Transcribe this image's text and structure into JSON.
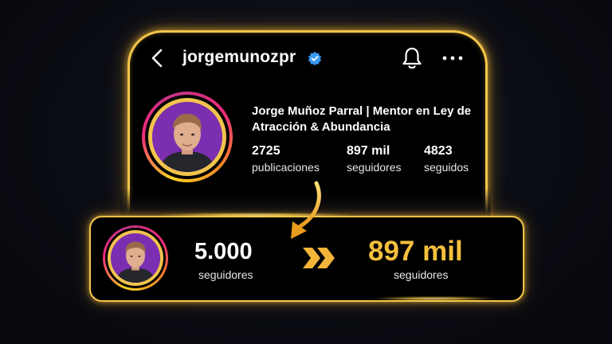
{
  "profile": {
    "username": "jorgemunozpr",
    "display_name": "Jorge Muñoz Parral | Mentor en Ley de Atracción & Abundancia",
    "stats": [
      {
        "value": "2725",
        "label": "publicaciones"
      },
      {
        "value": "897 mil",
        "label": "seguidores"
      },
      {
        "value": "4823",
        "label": "seguidos"
      }
    ]
  },
  "growth": {
    "before_value": "5.000",
    "before_label": "seguidores",
    "after_value": "897 mil",
    "after_label": "seguidores"
  },
  "icons": {
    "back": "chevron-left-icon",
    "verified": "verified-badge-icon",
    "notifications": "bell-icon",
    "more": "more-horizontal-icon",
    "arrow": "curved-arrow-icon",
    "progress": "double-chevron-right-icon"
  },
  "colors": {
    "accent_gold": "#f5bf3c",
    "verified_blue": "#3897f0",
    "avatar_background": "#7b2fb0"
  }
}
